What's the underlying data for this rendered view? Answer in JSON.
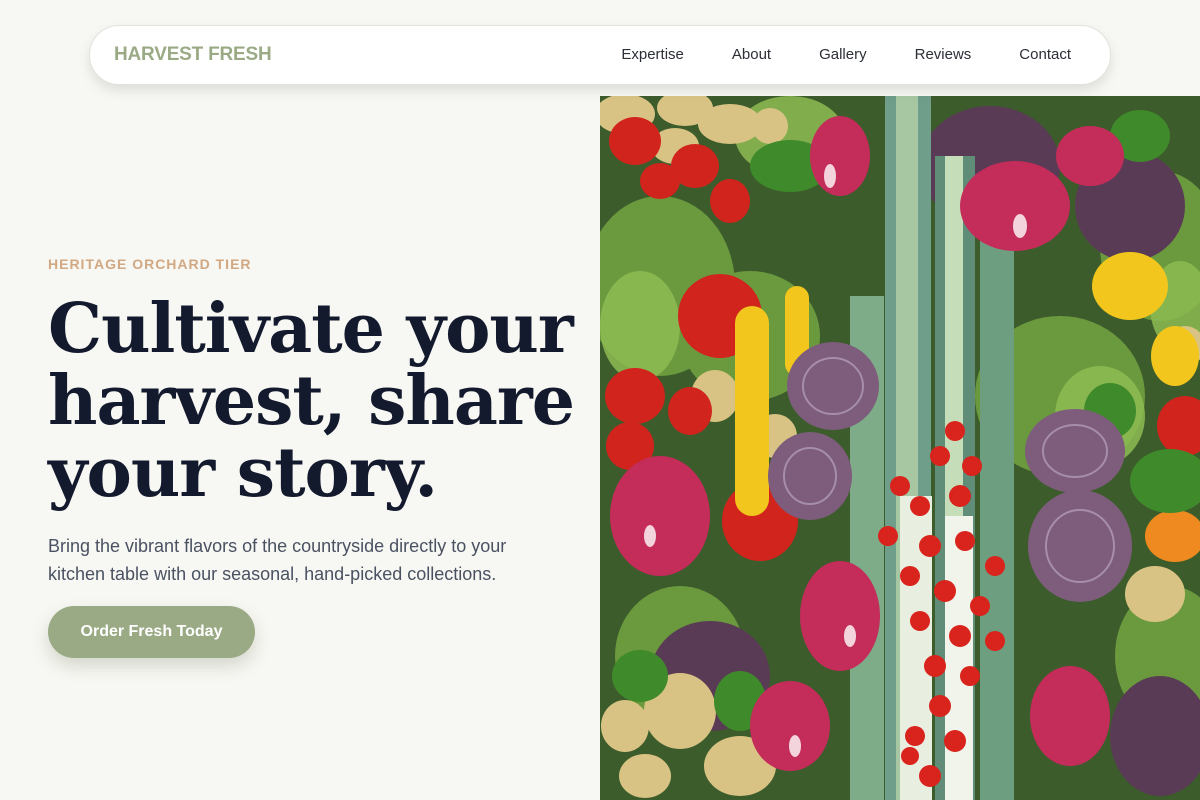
{
  "nav": {
    "logo": "HARVEST FRESH",
    "links": [
      "Expertise",
      "About",
      "Gallery",
      "Reviews",
      "Contact"
    ]
  },
  "hero": {
    "eyebrow": "HERITAGE ORCHARD TIER",
    "headline": "Cultivate your harvest, share your story.",
    "lede": "Bring the vibrant flavors of the countryside directly to your kitchen table with our seasonal, hand-picked collections.",
    "cta_label": "Order Fresh Today"
  },
  "colors": {
    "accent": "#9aaa85",
    "eyebrow": "#d2a882",
    "headline": "#141a2e",
    "background": "#f7f7f3"
  }
}
